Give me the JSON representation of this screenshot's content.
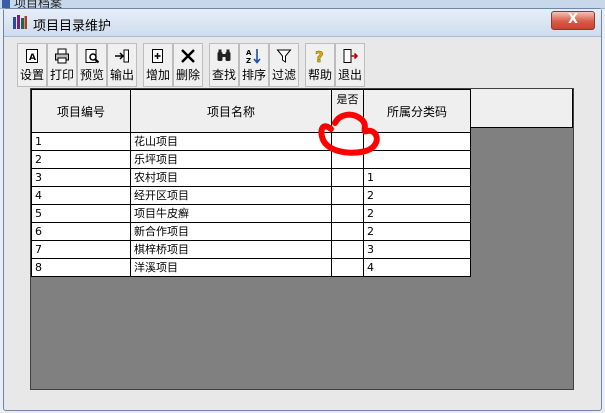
{
  "background_window": {
    "title": "项目档案"
  },
  "window": {
    "title": "项目目录维护",
    "close_label": "X"
  },
  "toolbar": {
    "groups": [
      [
        {
          "label": "设置",
          "icon": "settings-page-icon"
        },
        {
          "label": "打印",
          "icon": "printer-icon"
        },
        {
          "label": "预览",
          "icon": "preview-icon"
        },
        {
          "label": "输出",
          "icon": "export-icon"
        }
      ],
      [
        {
          "label": "增加",
          "icon": "add-icon"
        },
        {
          "label": "删除",
          "icon": "delete-icon"
        }
      ],
      [
        {
          "label": "查找",
          "icon": "binoculars-icon"
        },
        {
          "label": "排序",
          "icon": "sort-icon"
        },
        {
          "label": "过滤",
          "icon": "filter-icon"
        }
      ],
      [
        {
          "label": "帮助",
          "icon": "help-icon"
        },
        {
          "label": "退出",
          "icon": "exit-icon"
        }
      ]
    ]
  },
  "grid": {
    "columns": [
      "项目编号",
      "项目名称",
      "是否",
      "所属分类码"
    ],
    "rows": [
      {
        "id": "1",
        "name": "花山项目",
        "flag": "",
        "category": ""
      },
      {
        "id": "2",
        "name": "乐坪项目",
        "flag": "",
        "category": ""
      },
      {
        "id": "3",
        "name": "农村项目",
        "flag": "",
        "category": "1"
      },
      {
        "id": "4",
        "name": "经开区项目",
        "flag": "",
        "category": "2"
      },
      {
        "id": "5",
        "name": "项目牛皮癣",
        "flag": "",
        "category": "2"
      },
      {
        "id": "6",
        "name": "新合作项目",
        "flag": "",
        "category": "2"
      },
      {
        "id": "7",
        "name": "棋梓桥项目",
        "flag": "",
        "category": "3"
      },
      {
        "id": "8",
        "name": "洋溪项目",
        "flag": "",
        "category": "4"
      }
    ]
  },
  "colors": {
    "titlebar": "#cfdcee",
    "close_button": "#d85b45",
    "grid_background": "#808080",
    "annotation": "#ff0000"
  }
}
